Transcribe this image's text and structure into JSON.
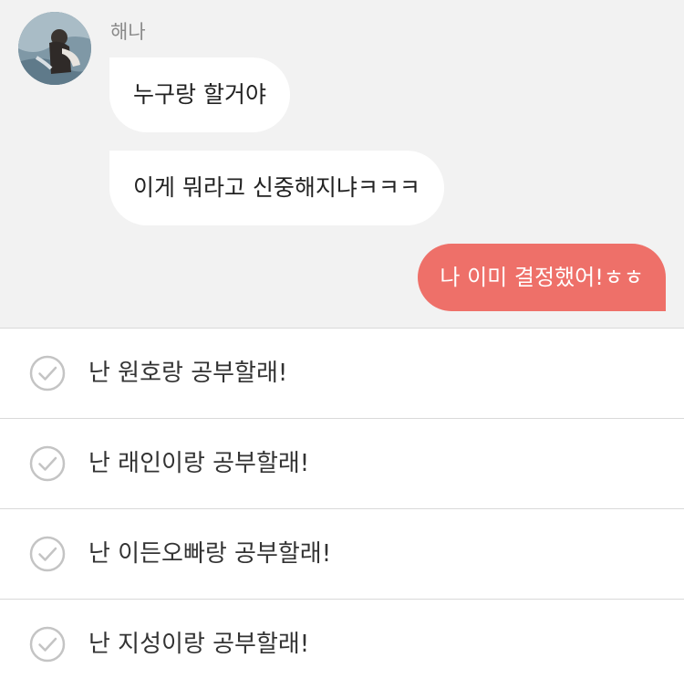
{
  "chat": {
    "sender_name": "해나",
    "incoming_messages": [
      {
        "text": "누구랑 할거야"
      },
      {
        "text": "이게 뭐라고 신중해지냐ㅋㅋㅋ"
      }
    ],
    "outgoing_messages": [
      {
        "text": "나 이미 결정했어!ㅎㅎ"
      }
    ],
    "colors": {
      "chat_background": "#f2f2f2",
      "incoming_bubble": "#ffffff",
      "outgoing_bubble": "#ee7069"
    }
  },
  "choices": {
    "items": [
      {
        "label": "난 원호랑 공부할래!",
        "icon": "check-circle-icon"
      },
      {
        "label": "난 래인이랑 공부할래!",
        "icon": "check-circle-icon"
      },
      {
        "label": "난 이든오빠랑 공부할래!",
        "icon": "check-circle-icon"
      },
      {
        "label": "난 지성이랑 공부할래!",
        "icon": "check-circle-icon"
      }
    ]
  }
}
